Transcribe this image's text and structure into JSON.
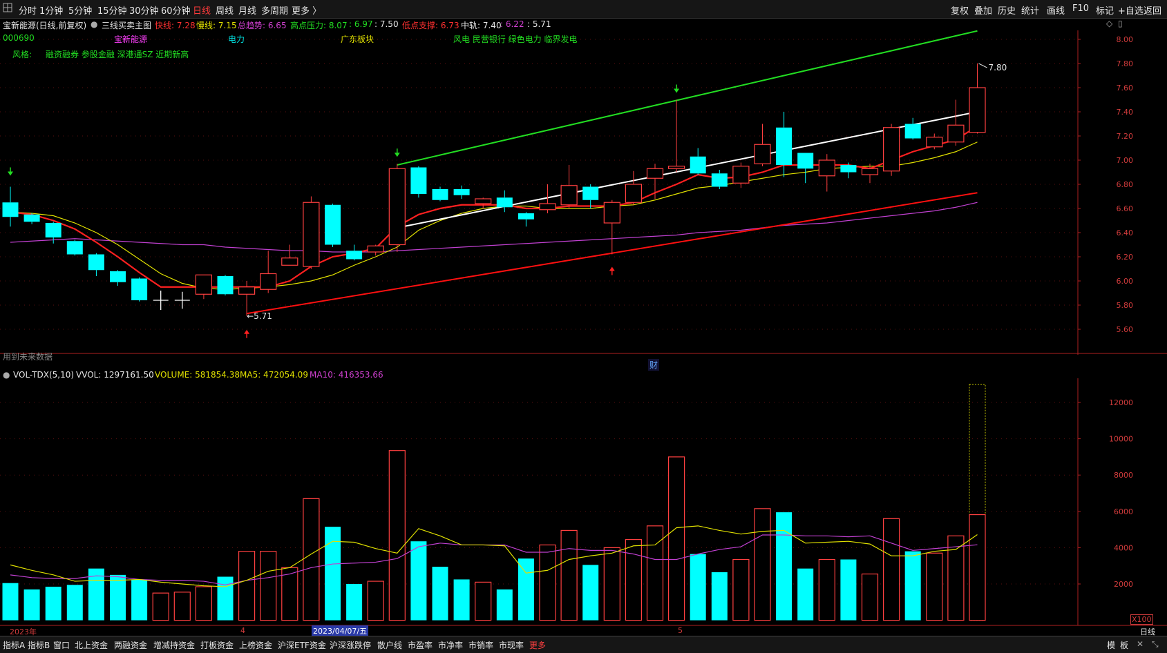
{
  "topbar": {
    "icon": "grid-icon",
    "tabs": [
      "分时",
      "1分钟",
      "5分钟",
      "15分钟",
      "30分钟",
      "60分钟",
      "日线",
      "周线",
      "月线",
      "多周期",
      "更多 〉"
    ],
    "active_tab": "日线",
    "right_buttons": [
      "复权",
      "叠加",
      "历史",
      "统计",
      "画线",
      "F10",
      "标记",
      "+自选",
      "返回"
    ]
  },
  "info": {
    "title": "宝新能源(日线,前复权)",
    "indicator_name": "三线买卖主图",
    "fast_label": "快线: 7.28",
    "slow_label": "慢线: 7.15",
    "trend_label": "总趋势: 6.65",
    "high_pressure": "高点压力: 8.07",
    "hp_v2": ": 6.97",
    "hp_v3": ": 7.50",
    "low_support": "低点支撑: 6.73",
    "mid_label": "中轨: 7.40",
    "mid_v2": ": 6.22",
    "mid_v3": ": 5.71",
    "code": "000690",
    "name": "宝新能源",
    "sector": "电力",
    "region": "广东板块",
    "concepts": "风电  民营银行  绿色电力  临界发电",
    "style_label": "风格:",
    "style_tags": "融资融券  参股金融  深港通SZ  近期新高",
    "future_note": "用到未来数据"
  },
  "annotations": {
    "high": "7.80",
    "low": "5.71",
    "cai": "财"
  },
  "volume_panel": {
    "title": "VOL-TDX(5,10)",
    "vvol": "VVOL: 1297161.50",
    "volume": "VOLUME: 581854.38",
    "ma5": "MA5: 472054.09",
    "ma10": "MA10: 416353.66",
    "unit": "X100"
  },
  "bottom": {
    "period": "日线",
    "date_labels": [
      "2023年",
      "4",
      "2023/04/07/五",
      "5"
    ],
    "tabs": [
      "指标A",
      "指标B",
      "窗口",
      "北上资金",
      "两融资金",
      "增减持资金",
      "打板资金",
      "上榜资金",
      "沪深ETF资金",
      "沪深涨跌停",
      "散户线",
      "市盈率",
      "市净率",
      "市销率",
      "市现率",
      "更多"
    ],
    "right_tabs": [
      "模",
      "板"
    ]
  },
  "colors": {
    "up": "#ff4040",
    "down": "#00ffff",
    "fast": "#ff2020",
    "slow": "#e0e000",
    "trend": "#c040d0",
    "resistance": "#22dd22",
    "support": "#ff1010",
    "mid": "#ffffff",
    "ma5": "#e0e000",
    "ma10": "#c040d0"
  },
  "chart_data": {
    "type": "candlestick",
    "price_axis": {
      "ticks": [
        "8.00",
        "7.80",
        "7.60",
        "7.40",
        "7.20",
        "7.00",
        "6.80",
        "6.60",
        "6.40",
        "6.20",
        "6.00",
        "5.80",
        "5.60"
      ],
      "range": [
        5.55,
        8.05
      ]
    },
    "volume_axis": {
      "ticks": [
        "12000",
        "10000",
        "8000",
        "6000",
        "4000",
        "2000"
      ],
      "range": [
        0,
        13500
      ]
    },
    "candles": [
      {
        "o": 6.65,
        "h": 6.78,
        "l": 6.45,
        "c": 6.53
      },
      {
        "o": 6.55,
        "h": 6.56,
        "l": 6.47,
        "c": 6.49
      },
      {
        "o": 6.48,
        "h": 6.49,
        "l": 6.31,
        "c": 6.36
      },
      {
        "o": 6.33,
        "h": 6.34,
        "l": 6.21,
        "c": 6.22
      },
      {
        "o": 6.22,
        "h": 6.23,
        "l": 6.04,
        "c": 6.09
      },
      {
        "o": 6.08,
        "h": 6.09,
        "l": 5.96,
        "c": 5.99
      },
      {
        "o": 6.02,
        "h": 6.03,
        "l": 5.83,
        "c": 5.84
      },
      {
        "o": 5.84,
        "h": 5.92,
        "l": 5.76,
        "c": 5.84,
        "doji": true
      },
      {
        "o": 5.84,
        "h": 5.91,
        "l": 5.77,
        "c": 5.84,
        "doji": true
      },
      {
        "o": 5.89,
        "h": 6.05,
        "l": 5.85,
        "c": 6.05
      },
      {
        "o": 6.04,
        "h": 6.05,
        "l": 5.88,
        "c": 5.89
      },
      {
        "o": 5.89,
        "h": 6.0,
        "l": 5.71,
        "c": 5.95
      },
      {
        "o": 5.93,
        "h": 6.25,
        "l": 5.9,
        "c": 6.06
      },
      {
        "o": 6.13,
        "h": 6.3,
        "l": 6.13,
        "c": 6.19
      },
      {
        "o": 6.12,
        "h": 6.7,
        "l": 6.1,
        "c": 6.65
      },
      {
        "o": 6.63,
        "h": 6.64,
        "l": 6.28,
        "c": 6.3
      },
      {
        "o": 6.25,
        "h": 6.3,
        "l": 6.17,
        "c": 6.18
      },
      {
        "o": 6.24,
        "h": 6.3,
        "l": 6.21,
        "c": 6.29
      },
      {
        "o": 6.3,
        "h": 6.97,
        "l": 6.24,
        "c": 6.93
      },
      {
        "o": 6.94,
        "h": 6.95,
        "l": 6.69,
        "c": 6.72
      },
      {
        "o": 6.76,
        "h": 6.78,
        "l": 6.66,
        "c": 6.67
      },
      {
        "o": 6.76,
        "h": 6.79,
        "l": 6.68,
        "c": 6.71
      },
      {
        "o": 6.64,
        "h": 6.69,
        "l": 6.6,
        "c": 6.68
      },
      {
        "o": 6.69,
        "h": 6.75,
        "l": 6.57,
        "c": 6.61
      },
      {
        "o": 6.56,
        "h": 6.57,
        "l": 6.45,
        "c": 6.51
      },
      {
        "o": 6.59,
        "h": 6.8,
        "l": 6.56,
        "c": 6.64
      },
      {
        "o": 6.63,
        "h": 6.96,
        "l": 6.6,
        "c": 6.79
      },
      {
        "o": 6.78,
        "h": 6.8,
        "l": 6.6,
        "c": 6.67
      },
      {
        "o": 6.48,
        "h": 6.67,
        "l": 6.22,
        "c": 6.65
      },
      {
        "o": 6.65,
        "h": 6.91,
        "l": 6.63,
        "c": 6.8
      },
      {
        "o": 6.85,
        "h": 6.97,
        "l": 6.68,
        "c": 6.93
      },
      {
        "o": 6.93,
        "h": 7.5,
        "l": 6.9,
        "c": 6.95
      },
      {
        "o": 7.03,
        "h": 7.1,
        "l": 6.88,
        "c": 6.89
      },
      {
        "o": 6.89,
        "h": 6.92,
        "l": 6.76,
        "c": 6.78
      },
      {
        "o": 6.81,
        "h": 6.98,
        "l": 6.77,
        "c": 6.95
      },
      {
        "o": 6.97,
        "h": 7.3,
        "l": 6.95,
        "c": 7.13
      },
      {
        "o": 7.27,
        "h": 7.4,
        "l": 6.86,
        "c": 6.96
      },
      {
        "o": 7.06,
        "h": 7.06,
        "l": 6.81,
        "c": 6.93
      },
      {
        "o": 6.87,
        "h": 7.05,
        "l": 6.74,
        "c": 7.0
      },
      {
        "o": 6.96,
        "h": 6.98,
        "l": 6.85,
        "c": 6.9
      },
      {
        "o": 6.88,
        "h": 6.97,
        "l": 6.81,
        "c": 6.93
      },
      {
        "o": 6.91,
        "h": 7.3,
        "l": 6.87,
        "c": 7.27
      },
      {
        "o": 7.3,
        "h": 7.35,
        "l": 7.17,
        "c": 7.18
      },
      {
        "o": 7.11,
        "h": 7.22,
        "l": 7.09,
        "c": 7.19
      },
      {
        "o": 7.15,
        "h": 7.5,
        "l": 7.12,
        "c": 7.29
      },
      {
        "o": 7.23,
        "h": 7.8,
        "l": 7.22,
        "c": 7.6
      }
    ],
    "volumes": [
      2050,
      1700,
      1850,
      1950,
      2850,
      2500,
      2250,
      1500,
      1550,
      1850,
      2400,
      3800,
      3800,
      2900,
      6700,
      5150,
      2000,
      2150,
      9350,
      4350,
      2950,
      2250,
      2100,
      1700,
      3400,
      4150,
      4950,
      3050,
      4000,
      4450,
      5200,
      9000,
      3650,
      2650,
      3350,
      6150,
      5950,
      2850,
      3350,
      3350,
      2550,
      5600,
      3800,
      3700,
      4650,
      13000
    ],
    "vol_last_actual": 5818.5,
    "fast_line": [
      6.57,
      6.55,
      6.5,
      6.43,
      6.32,
      6.2,
      6.07,
      5.95,
      5.95,
      5.95,
      5.95,
      5.95,
      5.95,
      6.0,
      6.12,
      6.2,
      6.23,
      6.27,
      6.45,
      6.55,
      6.6,
      6.63,
      6.63,
      6.63,
      6.6,
      6.6,
      6.62,
      6.62,
      6.62,
      6.65,
      6.73,
      6.8,
      6.88,
      6.85,
      6.86,
      6.9,
      6.96,
      6.96,
      6.96,
      6.96,
      6.93,
      7.0,
      7.07,
      7.12,
      7.17,
      7.28
    ],
    "slow_line": [
      6.57,
      6.56,
      6.54,
      6.48,
      6.4,
      6.3,
      6.18,
      6.06,
      5.98,
      5.94,
      5.93,
      5.94,
      5.95,
      5.97,
      6.0,
      6.05,
      6.13,
      6.2,
      6.28,
      6.42,
      6.5,
      6.56,
      6.6,
      6.62,
      6.62,
      6.6,
      6.6,
      6.6,
      6.62,
      6.63,
      6.67,
      6.72,
      6.77,
      6.79,
      6.82,
      6.85,
      6.88,
      6.9,
      6.93,
      6.94,
      6.95,
      6.95,
      6.98,
      7.02,
      7.07,
      7.15
    ],
    "trend_line": [
      6.32,
      6.33,
      6.34,
      6.35,
      6.34,
      6.33,
      6.32,
      6.31,
      6.3,
      6.3,
      6.28,
      6.27,
      6.26,
      6.25,
      6.25,
      6.24,
      6.24,
      6.24,
      6.25,
      6.26,
      6.27,
      6.28,
      6.29,
      6.3,
      6.31,
      6.32,
      6.33,
      6.34,
      6.35,
      6.36,
      6.37,
      6.38,
      6.4,
      6.41,
      6.42,
      6.44,
      6.46,
      6.47,
      6.48,
      6.5,
      6.52,
      6.54,
      6.56,
      6.58,
      6.61,
      6.65
    ],
    "ma5_vol": [
      3050,
      2750,
      2500,
      2150,
      2200,
      2200,
      2250,
      2100,
      2000,
      1900,
      1850,
      2200,
      2700,
      2900,
      3650,
      4350,
      4300,
      3950,
      3700,
      5050,
      4650,
      4150,
      4150,
      4100,
      2600,
      2750,
      3350,
      3550,
      3700,
      4100,
      4150,
      5100,
      5200,
      4950,
      4750,
      4900,
      4950,
      4250,
      4300,
      4350,
      4200,
      3550,
      3550,
      3800,
      3900,
      4720
    ],
    "ma10_vol": [
      2500,
      2350,
      2300,
      2300,
      2450,
      2400,
      2250,
      2200,
      2200,
      2150,
      1950,
      2200,
      2350,
      2550,
      2900,
      3100,
      3150,
      3200,
      3400,
      4050,
      4250,
      4150,
      4150,
      4150,
      3750,
      3750,
      3950,
      3850,
      3850,
      3650,
      3350,
      3350,
      3650,
      3900,
      4050,
      4700,
      4700,
      4650,
      4650,
      4600,
      4650,
      4250,
      3850,
      3950,
      4050,
      4160
    ],
    "resistance_line": {
      "from": [
        18,
        6.96
      ],
      "to": [
        45,
        8.07
      ]
    },
    "support_line": {
      "from": [
        11,
        5.73
      ],
      "to": [
        45,
        6.73
      ]
    },
    "mid_line": {
      "from": [
        18,
        6.44
      ],
      "to": [
        45,
        7.4
      ]
    }
  }
}
